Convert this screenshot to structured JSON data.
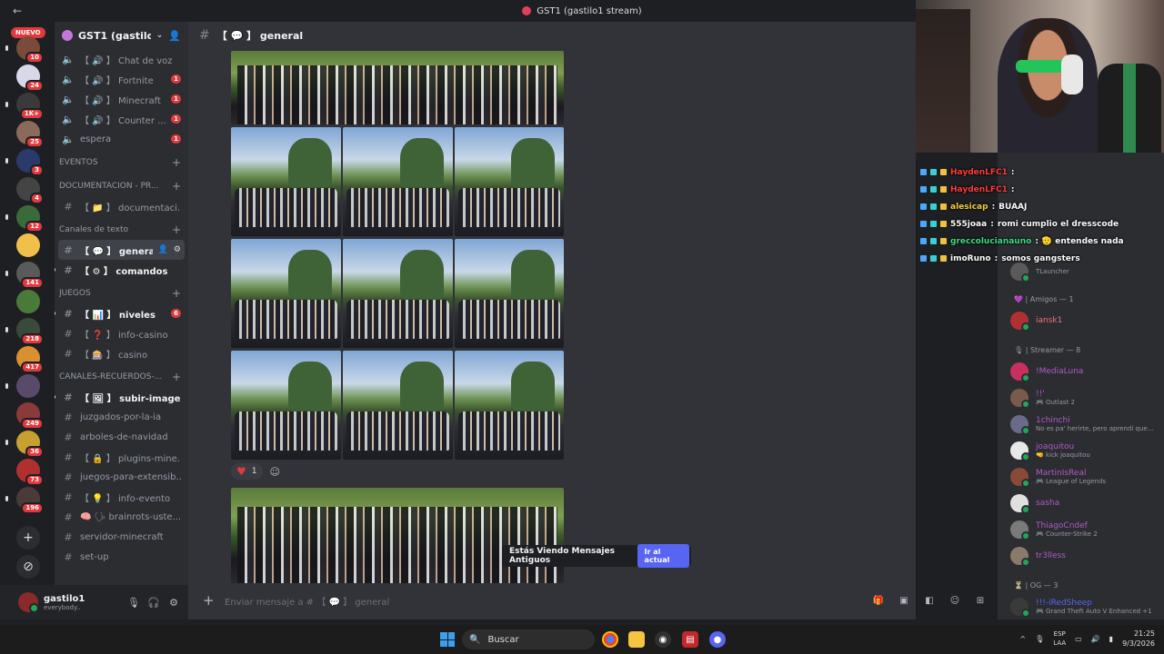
{
  "window": {
    "title": "GST1 (gastilo1 stream)"
  },
  "rail": {
    "new_badge": "NUEVO",
    "servers": [
      {
        "color": "#7a4a3a",
        "count": "10"
      },
      {
        "color": "#d8d8e8",
        "count": "24"
      },
      {
        "color": "#3a3a3a",
        "count": "1K+"
      },
      {
        "color": "#8a6a5a",
        "count": "25"
      },
      {
        "color": "#2a3a6a",
        "count": "3"
      },
      {
        "color": "#444444",
        "count": "4"
      },
      {
        "color": "#3a6a3a",
        "count": "12"
      },
      {
        "color": "#f0c04a",
        "count": ""
      },
      {
        "color": "#5a5a5a",
        "count": "141"
      },
      {
        "color": "#4a7a3a",
        "count": ""
      },
      {
        "color": "#3a4a3a",
        "count": "218"
      },
      {
        "color": "#d89030",
        "count": "417"
      },
      {
        "color": "#5a4a6a",
        "count": ""
      },
      {
        "color": "#8a3a3a",
        "count": "249"
      },
      {
        "color": "#c8a030",
        "count": "36"
      },
      {
        "color": "#b03030",
        "count": "73"
      },
      {
        "color": "#4a3a3a",
        "count": "196"
      }
    ]
  },
  "guild": {
    "name": "GST1 (gastilo1 ...",
    "icon": "guild-icon"
  },
  "channels": {
    "voice": [
      {
        "label": "【 🔊 】 Chat de voz",
        "badge": ""
      },
      {
        "label": "【 🔊 】 Fortnite",
        "badge": "1"
      },
      {
        "label": "【 🔊 】 Minecraft",
        "badge": "1"
      },
      {
        "label": "【 🔊 】 Counter ...",
        "badge": "1"
      },
      {
        "label": "espera",
        "badge": "1"
      }
    ],
    "eventos": "EVENTOS",
    "doc_category": "DOCUMENTACION - PR...",
    "doc_channel": "【 📁 】 documentaci...",
    "text_category": "Canales de texto",
    "general": "【 💬 】 general",
    "comandos": "【 ⚙ 】 comandos",
    "juegos_category": "JUEGOS",
    "niveles": "【 📊 】 niveles",
    "niveles_badge": "6",
    "info_casino": "【 ❓ 】 info-casino",
    "casino": "【 🎰 】 casino",
    "recuerdos_category": "CANALES-RECUERDOS-...",
    "recuerdos": [
      {
        "label": "【 🖼 】 subir-imagen",
        "bold": true
      },
      {
        "label": "juzgados-por-la-ia",
        "bold": false
      },
      {
        "label": "arboles-de-navidad",
        "bold": false
      },
      {
        "label": "【 🔒 】 plugins-mine...",
        "bold": false
      },
      {
        "label": "juegos-para-extensib...",
        "bold": false
      },
      {
        "label": "【 💡 】 info-evento",
        "bold": false
      },
      {
        "label": "🧠 🗣 brainrots-uste...",
        "bold": false
      },
      {
        "label": "servidor-minecraft",
        "bold": false
      },
      {
        "label": "set-up",
        "bold": false
      }
    ]
  },
  "user": {
    "name": "gastilo1",
    "status": "everybody..."
  },
  "main": {
    "channel_title": "【 💬 】 general",
    "reaction_count": "1",
    "old_messages_text": "Estás Viendo Mensajes Antiguos",
    "jump_label": "Ir al actual",
    "composer_placeholder": "Enviar mensaje a # 【 💬 】 general"
  },
  "chat": [
    {
      "user": "HaydenLFC1",
      "color": "#ff3b3b",
      "text": ""
    },
    {
      "user": "HaydenLFC1",
      "color": "#ff3b3b",
      "text": ""
    },
    {
      "user": "alesicap",
      "color": "#f4d03f",
      "text": "BUAAJ"
    },
    {
      "user": "555joaa",
      "color": "#ffffff",
      "text": "romi cumplio el dresscode"
    },
    {
      "user": "greccolucianauno",
      "color": "#3ddc84",
      "text": "🫡 entendes nada"
    },
    {
      "user": "imoRuno",
      "color": "#ffffff",
      "text": "somos gangsters"
    }
  ],
  "members": {
    "top_partial": {
      "name": "TLauncher"
    },
    "friends_group": "💜 | Amigos — 1",
    "friends": [
      {
        "name": "iansk1",
        "color": "#f07070",
        "activity": "",
        "avatar": "#b03030"
      }
    ],
    "streamer_group": "🎙 | Streamer — 8",
    "streamers": [
      {
        "name": "!MediaLuna",
        "color": "#b05ac8",
        "activity": "",
        "avatar": "#c83060"
      },
      {
        "name": "!!'",
        "color": "#b05ac8",
        "activity": "🎮 Outlast 2",
        "avatar": "#7a5a4a"
      },
      {
        "name": "1chinchi",
        "color": "#b05ac8",
        "activity": "No es pa' herirte, pero aprendí que...",
        "avatar": "#6a6a8a"
      },
      {
        "name": "joaquitou",
        "color": "#b05ac8",
        "activity": "🤜 kick joaquitou",
        "avatar": "#e8e8e8"
      },
      {
        "name": "MartinIsReal",
        "color": "#b05ac8",
        "activity": "🎮 League of Legends",
        "avatar": "#8a4a3a"
      },
      {
        "name": "sasha",
        "color": "#b05ac8",
        "activity": "",
        "avatar": "#e0e0e0"
      },
      {
        "name": "ThiagoCndef",
        "color": "#b05ac8",
        "activity": "🎮 Counter-Strike 2",
        "avatar": "#7a7a7a"
      },
      {
        "name": "tr3lless",
        "color": "#b05ac8",
        "activity": "",
        "avatar": "#8a7a6a"
      }
    ],
    "og_group": "⏳ | OG — 3",
    "og": [
      {
        "name": "!!!-iRedSheep",
        "color": "#5865f2",
        "activity": "🎮 Grand Theft Auto V Enhanced +1",
        "avatar": "#3a3a3a"
      }
    ]
  },
  "taskbar": {
    "search_label": "Buscar",
    "lang_top": "ESP",
    "lang_bottom": "LAA",
    "time": "21:25",
    "date": "9/3/2026"
  }
}
